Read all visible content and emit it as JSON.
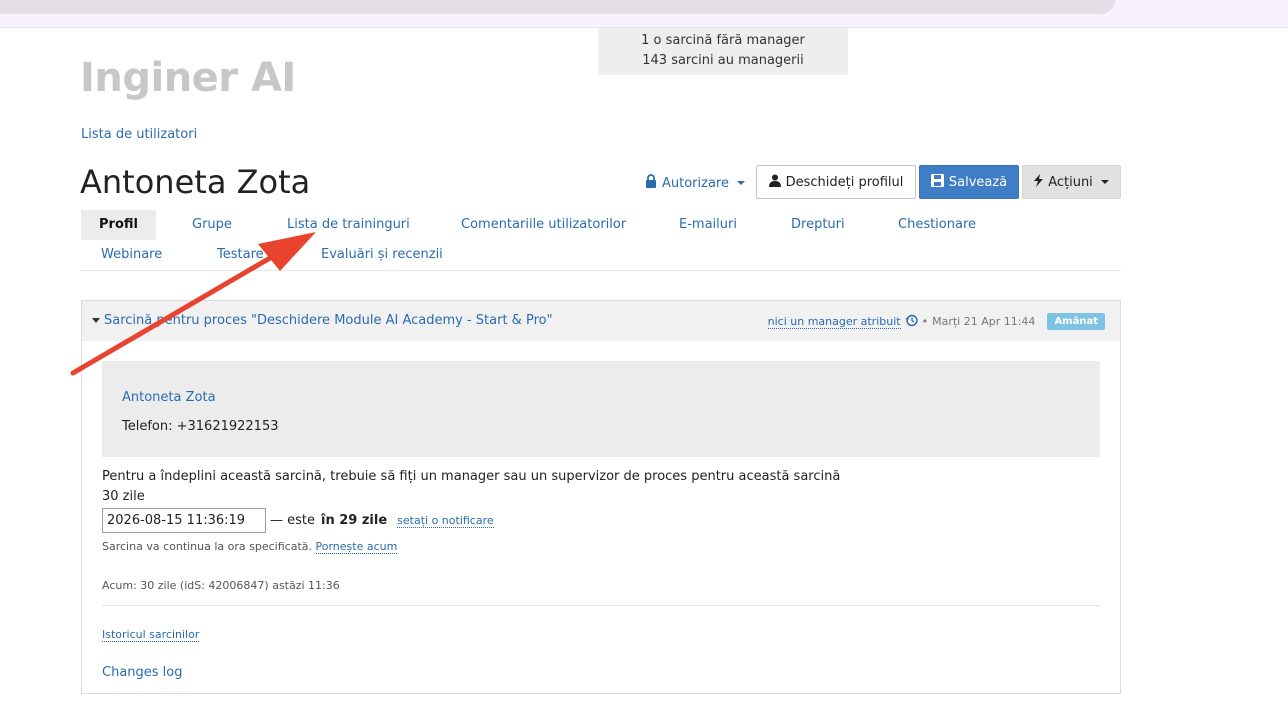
{
  "top": {
    "tasks_without_manager": "1 o sarcină fără manager",
    "tasks_with_manager": "143 sarcini au managerii"
  },
  "brand": "Inginer AI",
  "breadcrumb": {
    "users_list": "Lista de utilizatori"
  },
  "user": {
    "name": "Antoneta Zota"
  },
  "toolbar": {
    "auth_label": "Autorizare",
    "open_profile_label": "Deschideți profilul",
    "save_label": "Salvează",
    "actions_label": "Acțiuni"
  },
  "tabs": [
    {
      "label": "Profil",
      "active": true
    },
    {
      "label": "Grupe"
    },
    {
      "label": "Lista de traininguri"
    },
    {
      "label": "Comentariile utilizatorilor"
    },
    {
      "label": "E-mailuri"
    },
    {
      "label": "Drepturi"
    },
    {
      "label": "Chestionare"
    },
    {
      "label": "Webinare"
    },
    {
      "label": "Testare"
    },
    {
      "label": "Evaluări și recenzii"
    }
  ],
  "task": {
    "title": "Sarcină pentru proces \"Deschidere Module AI Academy - Start & Pro\"",
    "manager_link": "nici un manager atribuit",
    "date": "Marți 21 Apr 11:44",
    "status_badge": "Amânat",
    "contact_name": "Antoneta Zota",
    "contact_phone": "Telefon: +31621922153",
    "requirement_text": "Pentru a îndeplini această sarcină, trebuie să fiți un manager sau un supervizor de proces pentru această sarcină",
    "duration": "30 zile",
    "datetime_value": "2026-08-15 11:36:19",
    "is_prefix": "— este",
    "is_value": "în 29 zile",
    "notification_link": "setați o notificare",
    "continue_text": "Sarcina va continua la ora specificată.",
    "start_now_link": "Pornește acum",
    "now_text": "Acum: 30 zile (idS: 42006847) astăzi 11:36",
    "history_link": "Istoricul sarcinilor",
    "changes_log_link": "Changes log"
  },
  "colors": {
    "link": "#2a6bb0",
    "save_button": "#3f7ec6",
    "badge": "#7ec2e4",
    "arrow": "#e8432f"
  }
}
